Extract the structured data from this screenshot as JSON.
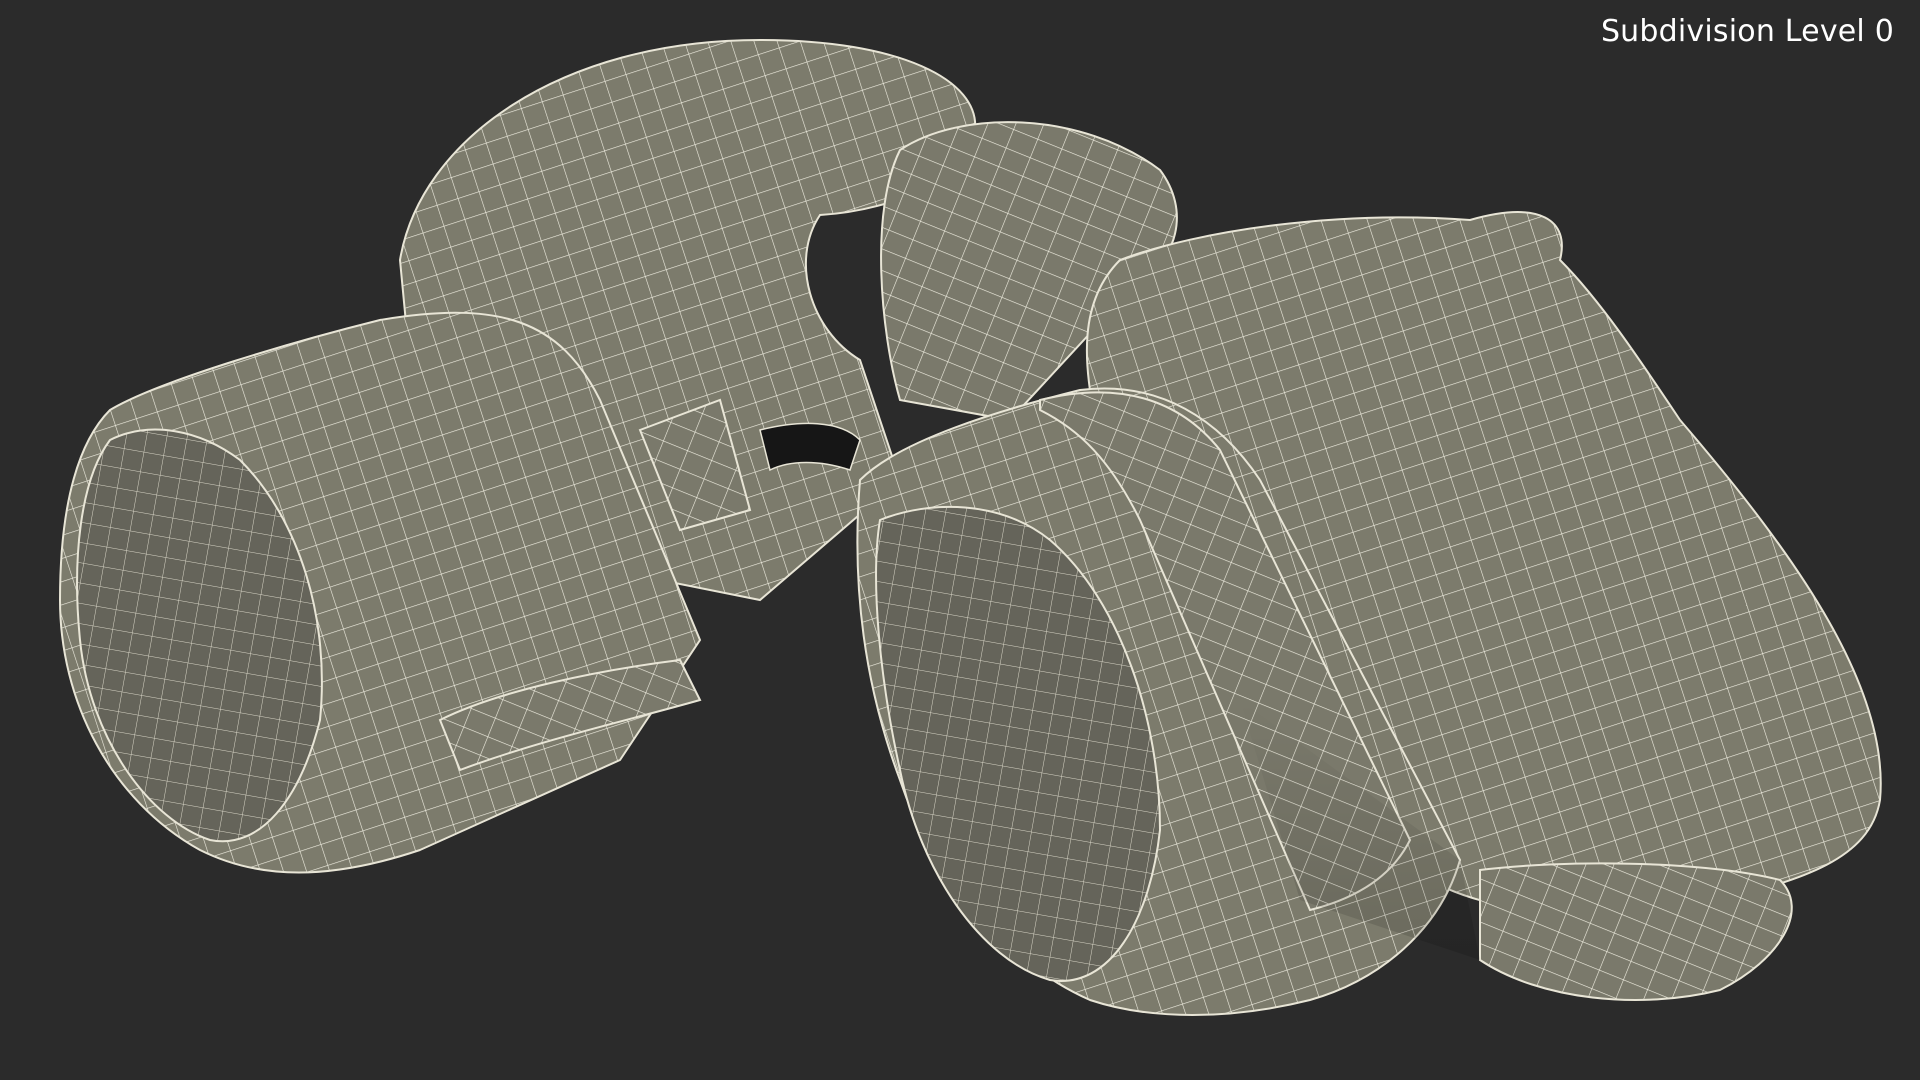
{
  "overlay": {
    "label": "Subdivision Level 0"
  },
  "scene": {
    "subject": "boxing-gloves-wireframe",
    "background_color": "#2b2b2b",
    "surface_color": "#7c7b6c",
    "shadow_color": "#5e5d52",
    "wire_color": "#f1efe2"
  }
}
